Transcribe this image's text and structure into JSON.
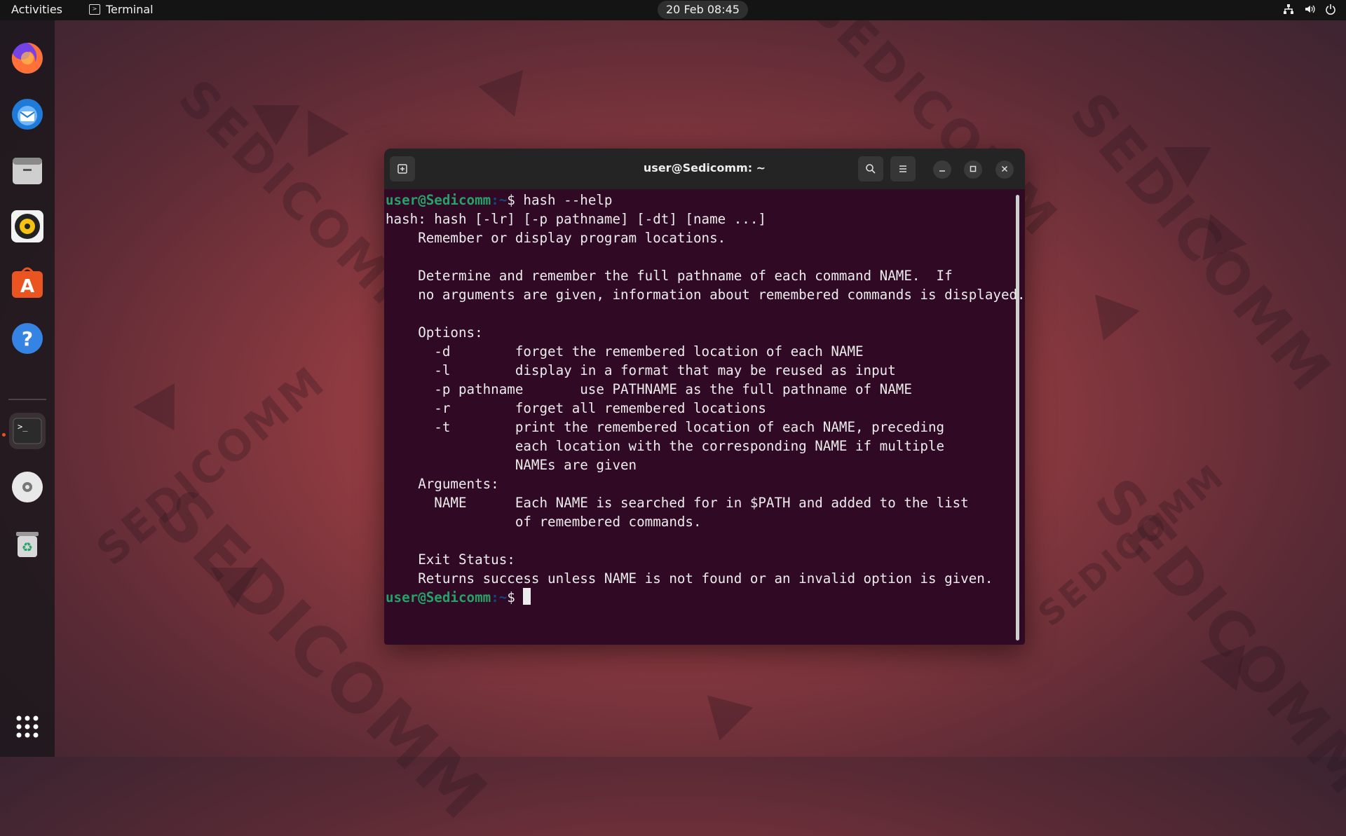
{
  "topbar": {
    "activities": "Activities",
    "app_name": "Terminal",
    "clock": "20 Feb  08:45"
  },
  "dock": {
    "items": [
      "firefox-icon",
      "thunderbird-icon",
      "files-icon",
      "rhythmbox-icon",
      "app-center-icon",
      "help-icon",
      "terminal-icon",
      "disc-icon",
      "trash-icon",
      "app-grid-icon"
    ]
  },
  "wallpaper": {
    "watermark": "SEDICOMM"
  },
  "window": {
    "title": "user@Sedicomm: ~"
  },
  "terminal": {
    "prompt_user": "user@Sedicomm",
    "prompt_path": ":~",
    "prompt_symbol": "$ ",
    "command": "hash --help",
    "output": [
      "hash: hash [-lr] [-p pathname] [-dt] [name ...]",
      "    Remember or display program locations.",
      "",
      "    Determine and remember the full pathname of each command NAME.  If",
      "    no arguments are given, information about remembered commands is displayed.",
      "",
      "    Options:",
      "      -d        forget the remembered location of each NAME",
      "      -l        display in a format that may be reused as input",
      "      -p pathname       use PATHNAME as the full pathname of NAME",
      "      -r        forget all remembered locations",
      "      -t        print the remembered location of each NAME, preceding",
      "                each location with the corresponding NAME if multiple",
      "                NAMEs are given",
      "    Arguments:",
      "      NAME      Each NAME is searched for in $PATH and added to the list",
      "                of remembered commands.",
      "",
      "    Exit Status:",
      "    Returns success unless NAME is not found or an invalid option is given."
    ]
  },
  "colors": {
    "terminal_bg": "#300a24",
    "prompt_user": "#26a269",
    "accent": "#e95420"
  }
}
